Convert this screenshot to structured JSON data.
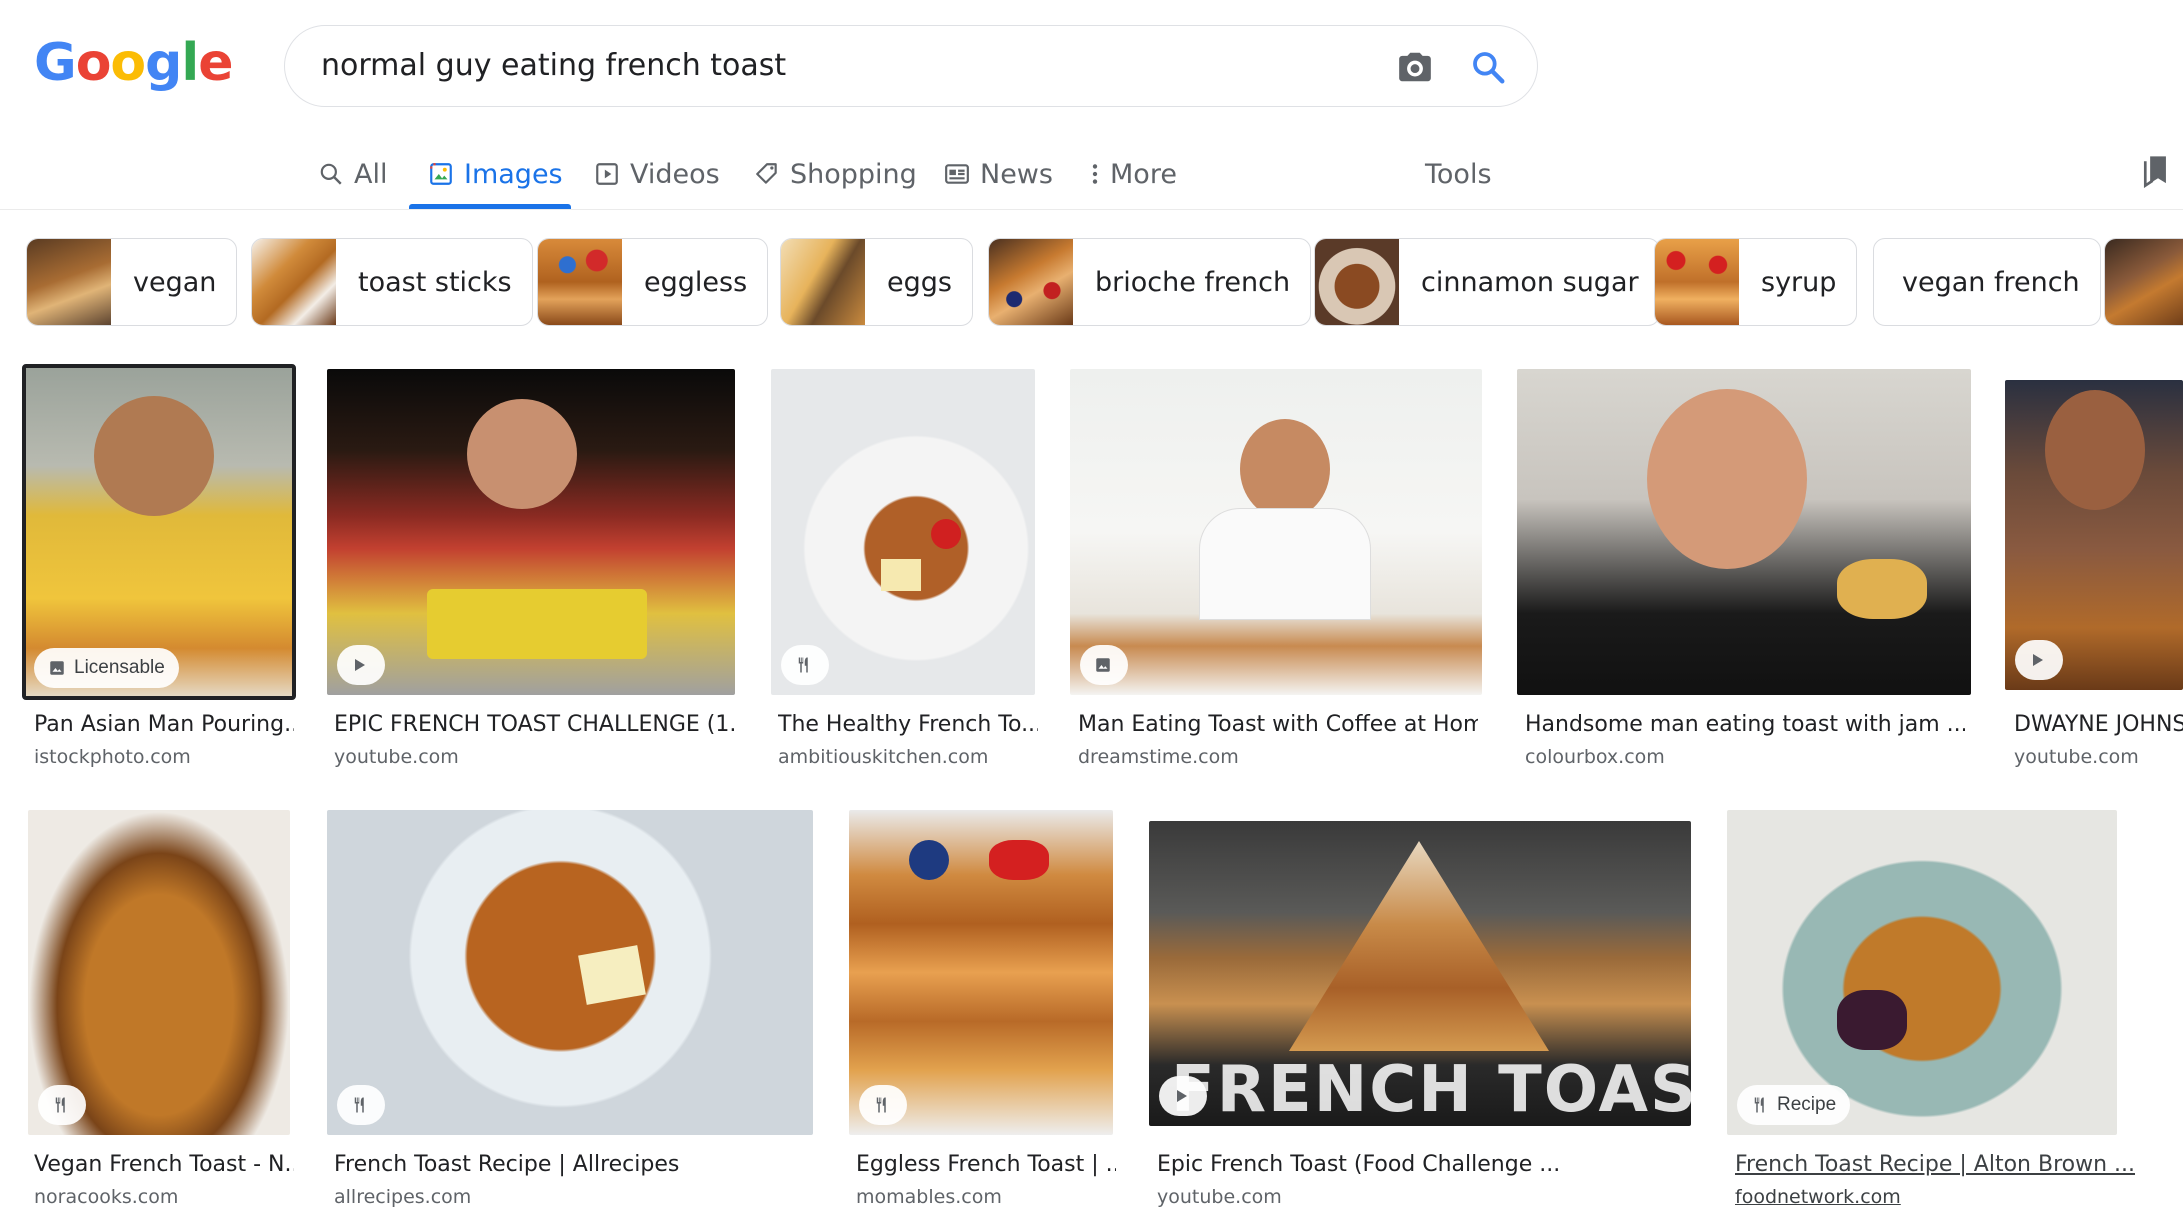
{
  "logo": {
    "letters": [
      "G",
      "o",
      "o",
      "g",
      "l",
      "e"
    ],
    "colors": [
      "#4285f4",
      "#ea4335",
      "#fbbc05",
      "#4285f4",
      "#34a853",
      "#ea4335"
    ]
  },
  "search": {
    "query": "normal guy eating french toast"
  },
  "tabs": [
    {
      "label": "All",
      "icon": "search-icon"
    },
    {
      "label": "Images",
      "icon": "image-icon",
      "active": true
    },
    {
      "label": "Videos",
      "icon": "video-icon"
    },
    {
      "label": "Shopping",
      "icon": "tag-icon"
    },
    {
      "label": "News",
      "icon": "news-icon"
    },
    {
      "label": "More",
      "icon": "more-vert-icon"
    },
    {
      "label": "Tools"
    }
  ],
  "chips": [
    {
      "label": "vegan"
    },
    {
      "label": "toast sticks"
    },
    {
      "label": "eggless"
    },
    {
      "label": "eggs"
    },
    {
      "label": "brioche french"
    },
    {
      "label": "cinnamon sugar"
    },
    {
      "label": "syrup"
    },
    {
      "label": "vegan french"
    }
  ],
  "results": [
    {
      "title": "Pan Asian Man Pouring...",
      "source": "istockphoto.com",
      "badge": "Licensable",
      "badge_icon": "image-icon"
    },
    {
      "title": "EPIC FRENCH TOAST CHALLENGE (1...",
      "source": "youtube.com",
      "badge_icon": "play-icon"
    },
    {
      "title": "The Healthy French To...",
      "source": "ambitiouskitchen.com",
      "badge_icon": "recipe-icon"
    },
    {
      "title": "Man Eating Toast with Coffee at Hom...",
      "source": "dreamstime.com",
      "badge_icon": "image-icon"
    },
    {
      "title": "Handsome man eating toast with jam ...",
      "source": "colourbox.com"
    },
    {
      "title": "DWAYNE JOHNS",
      "source": "youtube.com",
      "badge_icon": "play-icon"
    },
    {
      "title": "Vegan French Toast - N...",
      "source": "noracooks.com",
      "badge_icon": "recipe-icon"
    },
    {
      "title": "French Toast Recipe | Allrecipes",
      "source": "allrecipes.com",
      "badge_icon": "recipe-icon"
    },
    {
      "title": "Eggless French Toast | ...",
      "source": "momables.com",
      "badge_icon": "recipe-icon"
    },
    {
      "title": "Epic French Toast (Food Challenge ...",
      "source": "youtube.com",
      "badge_icon": "play-icon",
      "overlay_text": "FRENCH TOAST"
    },
    {
      "title": "French Toast Recipe | Alton Brown ...",
      "source": "foodnetwork.com",
      "badge": "Recipe",
      "badge_icon": "recipe-icon"
    }
  ],
  "colors": {
    "accent": "#1a73e8",
    "text": "#202124",
    "muted": "#5f6368"
  }
}
